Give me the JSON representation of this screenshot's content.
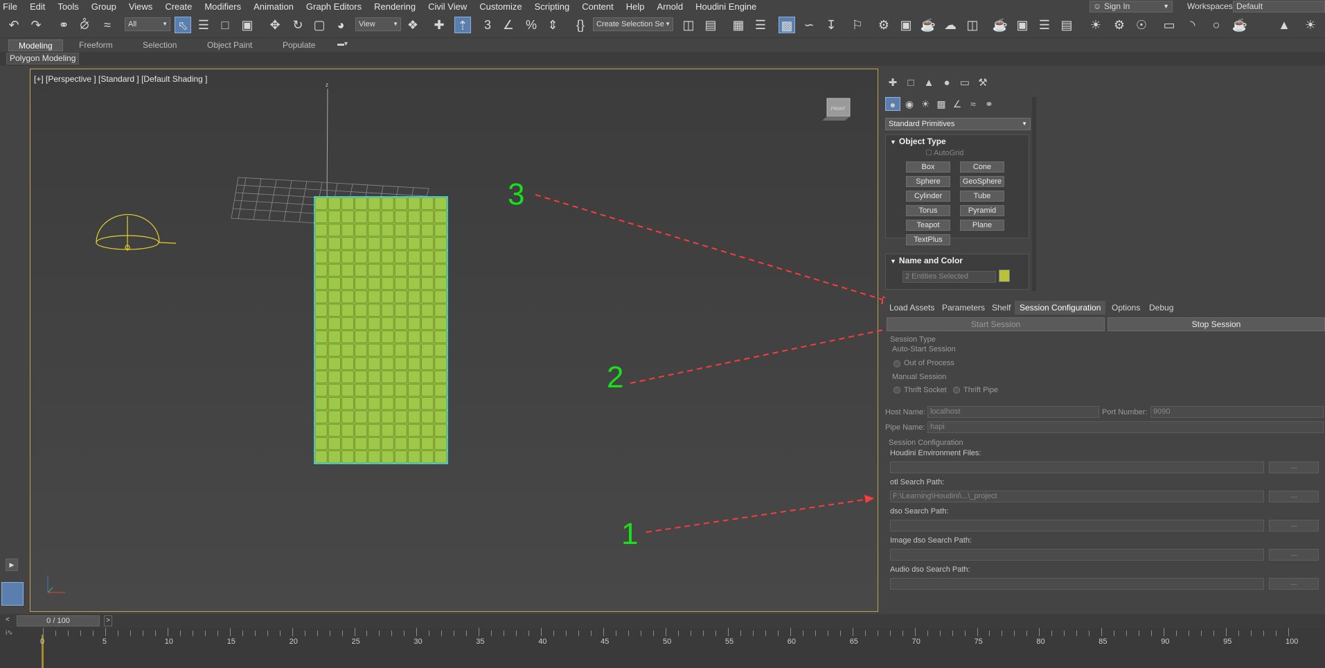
{
  "menu": [
    "File",
    "Edit",
    "Tools",
    "Group",
    "Views",
    "Create",
    "Modifiers",
    "Animation",
    "Graph Editors",
    "Rendering",
    "Civil View",
    "Customize",
    "Scripting",
    "Content",
    "Help",
    "Arnold",
    "Houdini Engine"
  ],
  "signin": "Sign In",
  "workspaces_label": "Workspaces:",
  "workspace_value": "Default",
  "toolbar": {
    "filter_value": "All",
    "view_value": "View",
    "selection_set": "Create Selection Se"
  },
  "ribbon": {
    "tabs": [
      "Modeling",
      "Freeform",
      "Selection",
      "Object Paint",
      "Populate"
    ],
    "subtab": "Polygon Modeling"
  },
  "viewport": {
    "label": "[+] [Perspective ] [Standard ] [Default Shading ]",
    "cube_label": "FRONT",
    "axis_z": "z"
  },
  "command_panel": {
    "dropdown": "Standard Primitives",
    "object_type_title": "Object Type",
    "autogrid": "AutoGrid",
    "primitives": [
      "Box",
      "Cone",
      "Sphere",
      "GeoSphere",
      "Cylinder",
      "Tube",
      "Torus",
      "Pyramid",
      "Teapot",
      "Plane",
      "TextPlus"
    ],
    "name_color_title": "Name and Color",
    "name_value": "2 Entities Selected",
    "color": "#b8c23a"
  },
  "houdini": {
    "tabs": [
      "Load Assets",
      "Parameters",
      "Shelf",
      "Session Configuration",
      "Options",
      "Debug"
    ],
    "start_session": "Start Session",
    "stop_session": "Stop Session",
    "session_type": "Session Type",
    "auto_start": "Auto-Start Session",
    "out_of_process": "Out of Process",
    "manual_session": "Manual Session",
    "thrift_socket": "Thrift Socket",
    "thrift_pipe": "Thrift Pipe",
    "host_label": "Host Name:",
    "host_value": "localhost",
    "port_label": "Port Number:",
    "port_value": "9090",
    "pipe_label": "Pipe Name:",
    "pipe_value": "hapi",
    "session_config": "Session Configuration",
    "env_files": "Houdini Environment Files:",
    "otl_path": "otl Search Path:",
    "otl_value": "F:\\Learning\\Houdini\\...\\_project",
    "dso_path": "dso Search Path:",
    "image_dso_path": "Image dso Search Path:",
    "audio_dso_path": "Audio dso Search Path:",
    "browse": "..."
  },
  "timeline": {
    "frame": "0 / 100",
    "ticks": [
      "0",
      "5",
      "10",
      "15",
      "20",
      "25",
      "30",
      "35",
      "40",
      "45",
      "50",
      "55",
      "60",
      "65",
      "70",
      "75",
      "80",
      "85",
      "90",
      "95",
      "100"
    ]
  },
  "annotations": [
    "1",
    "2",
    "3"
  ],
  "colors": {
    "annotation_green": "#18e01a",
    "arrow_red": "#ff3b3b",
    "selection_cyan": "#40e8ff",
    "grid_green": "#9bc23c",
    "viewport_border": "#c9a24a"
  }
}
